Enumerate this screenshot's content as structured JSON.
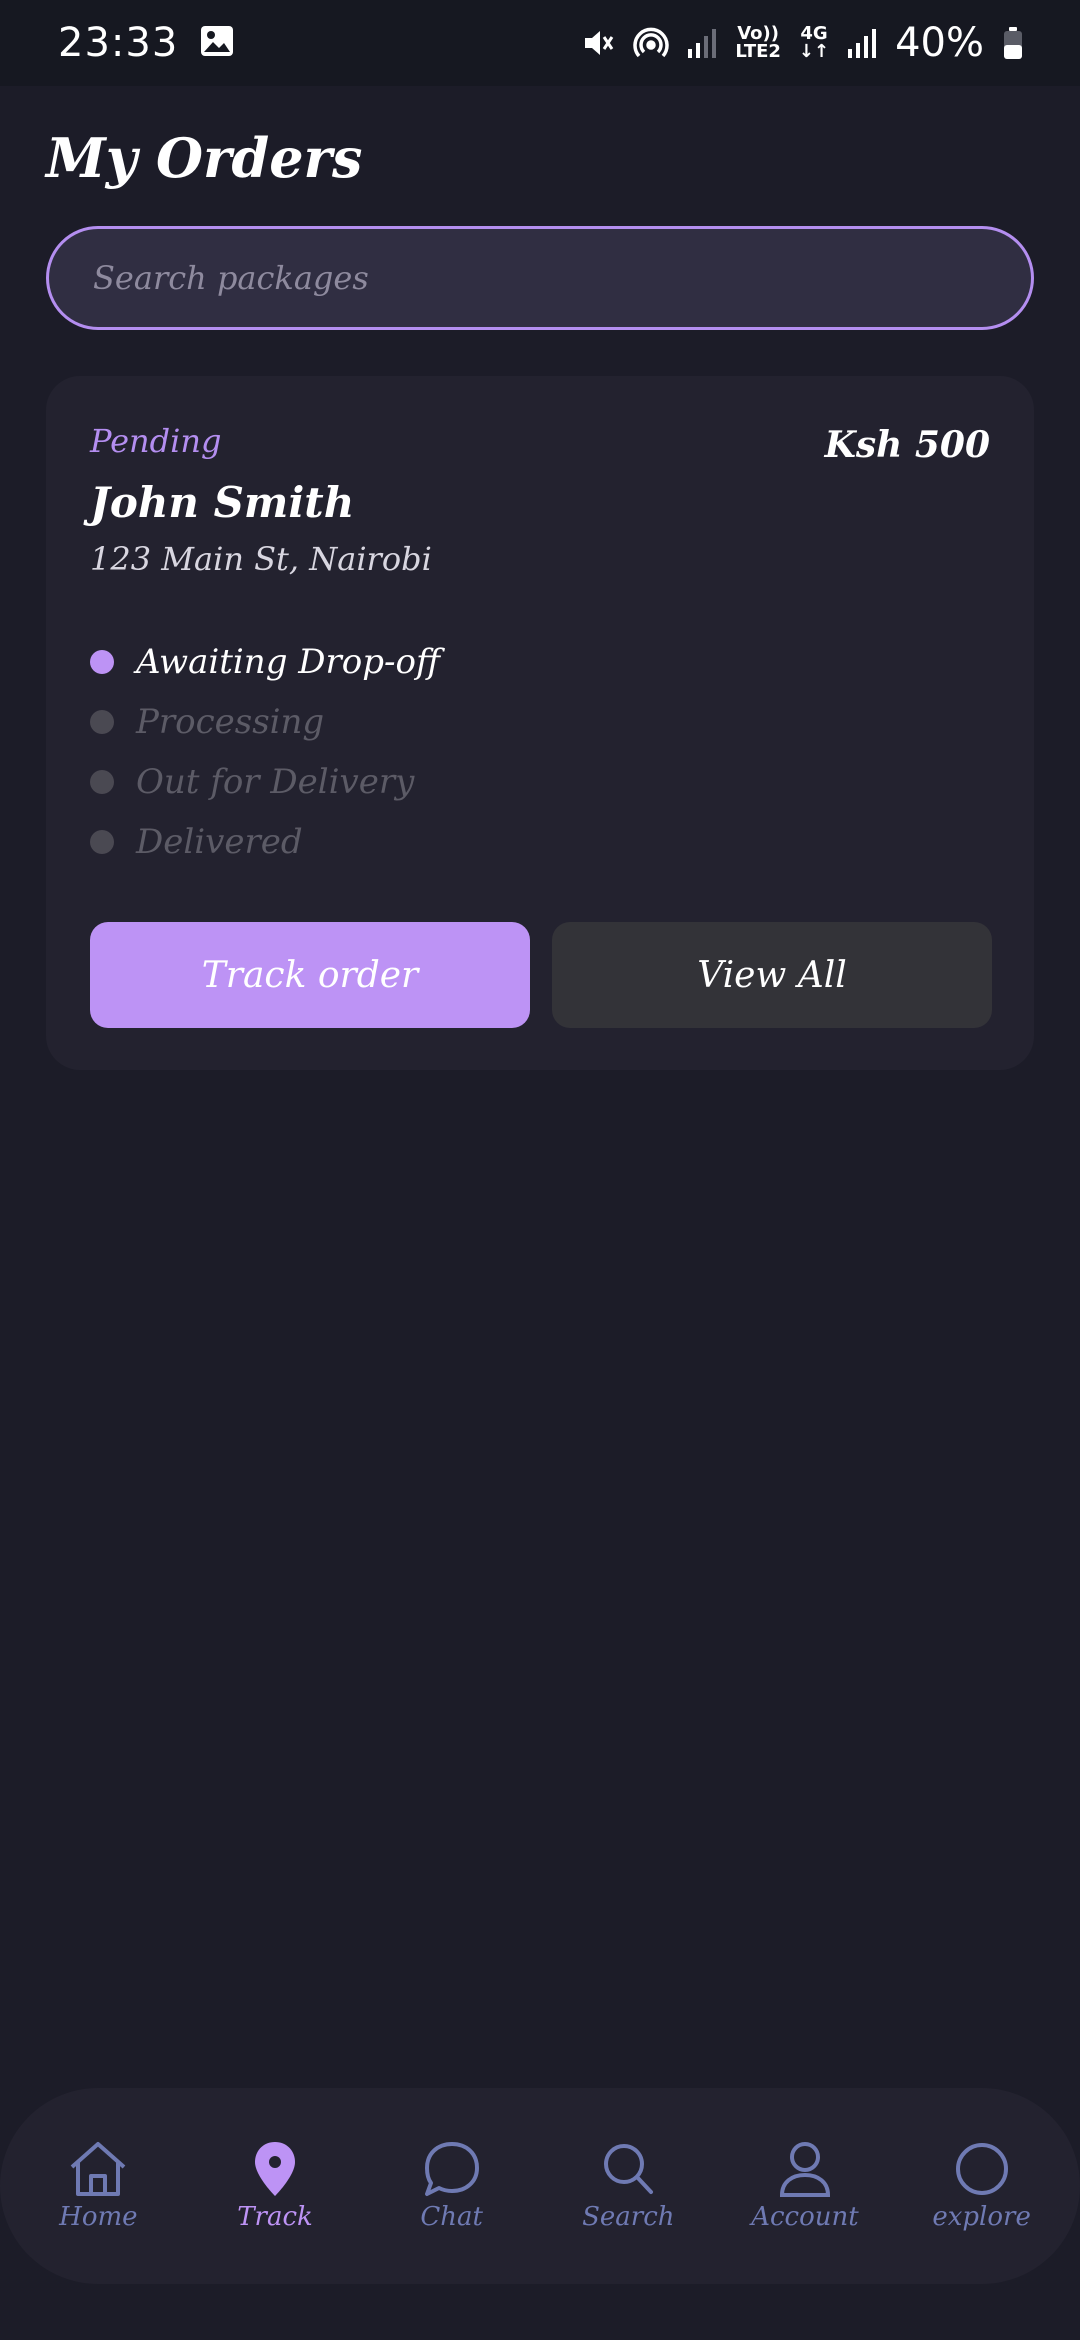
{
  "status_bar": {
    "time": "23:33",
    "network_top": "Vo))",
    "network_bottom": "LTE2",
    "network_gen": "4G",
    "battery": "40%"
  },
  "header": {
    "title": "My Orders"
  },
  "search": {
    "placeholder": "Search packages",
    "value": ""
  },
  "order": {
    "status": "Pending",
    "price": "Ksh 500",
    "customer": "John Smith",
    "address": "123 Main St, Nairobi",
    "steps": [
      {
        "label": "Awaiting Drop-off",
        "active": true
      },
      {
        "label": "Processing",
        "active": false
      },
      {
        "label": "Out for Delivery",
        "active": false
      },
      {
        "label": "Delivered",
        "active": false
      }
    ],
    "track_label": "Track order",
    "view_all_label": "View All"
  },
  "nav": {
    "items": [
      {
        "label": "Home",
        "icon": "home-icon",
        "active": false
      },
      {
        "label": "Track",
        "icon": "location-pin-icon",
        "active": true
      },
      {
        "label": "Chat",
        "icon": "chat-icon",
        "active": false
      },
      {
        "label": "Search",
        "icon": "search-icon",
        "active": false
      },
      {
        "label": "Account",
        "icon": "user-icon",
        "active": false
      },
      {
        "label": "explore",
        "icon": "explore-icon",
        "active": false
      }
    ]
  },
  "colors": {
    "accent": "#bd93f5",
    "background": "#1c1c28",
    "card": "#23222f",
    "nav_inactive": "#6f7ab3"
  }
}
